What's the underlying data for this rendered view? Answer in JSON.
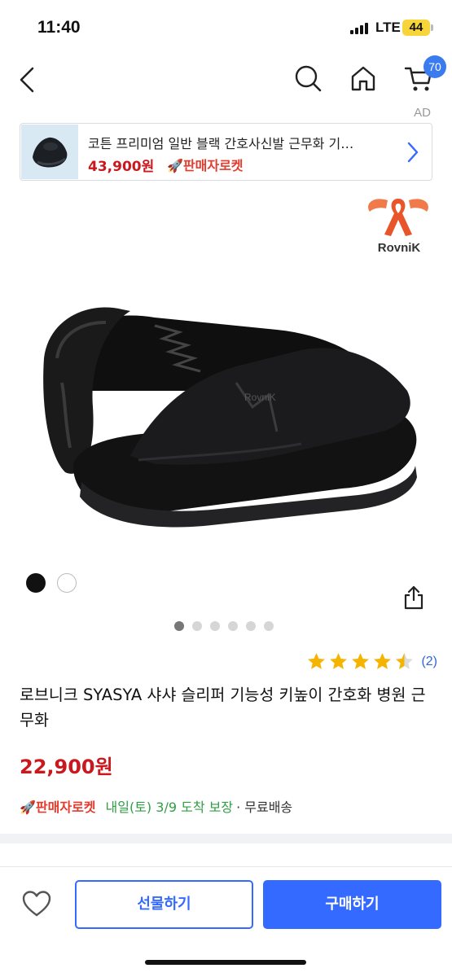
{
  "status_bar": {
    "time": "11:40",
    "network": "LTE",
    "battery": "44"
  },
  "nav": {
    "back_icon": "chevron-left-icon",
    "search_icon": "search-icon",
    "home_icon": "home-icon",
    "cart_icon": "cart-icon",
    "cart_count": "70"
  },
  "ad": {
    "label": "AD",
    "title": "코튼 프리미엄 일반 블랙 간호사신발 근무화 기…",
    "price": "43,900원",
    "badge": "🚀판매자로켓"
  },
  "brand": {
    "name": "RovniK"
  },
  "gallery": {
    "color_options": [
      "black",
      "white"
    ],
    "image_count": 6,
    "active_index": 0
  },
  "product": {
    "rating": 4.5,
    "review_count": "(2)",
    "title": "로브니크 SYASYA 샤샤 슬리퍼 기능성 키높이 간호화 병원 근무화",
    "price": "22,900원"
  },
  "delivery": {
    "badge": "🚀판매자로켓",
    "arrival": "내일(토) 3/9 도착 보장",
    "shipping": "· 무료배송"
  },
  "bottom_bar": {
    "gift_label": "선물하기",
    "buy_label": "구매하기"
  },
  "colors": {
    "accent": "#346aff",
    "price_red": "#c9181e",
    "rocket_red": "#e43b2d",
    "arrival_green": "#2f9e44",
    "star": "#f5b400"
  }
}
